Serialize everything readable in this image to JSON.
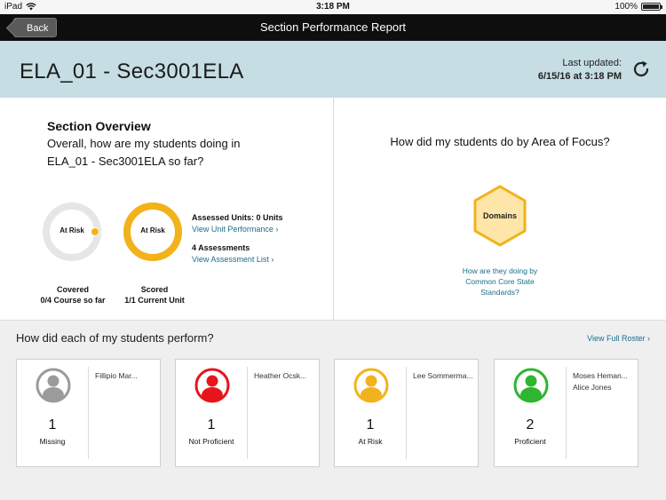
{
  "status_bar": {
    "device": "iPad",
    "time": "3:18 PM",
    "battery": "100%"
  },
  "nav": {
    "back_label": "Back",
    "title": "Section Performance Report"
  },
  "header": {
    "section_title": "ELA_01 - Sec3001ELA",
    "last_updated_label": "Last updated:",
    "last_updated_value": "6/15/16 at 3:18 PM"
  },
  "overview": {
    "heading": "Section Overview",
    "question_line1": "Overall, how are my students doing in",
    "question_line2": "ELA_01 - Sec3001ELA so far?",
    "covered": {
      "ring_label": "At Risk",
      "caption_title": "Covered",
      "caption_value": "0/4 Course so far"
    },
    "scored": {
      "ring_label": "At Risk",
      "caption_title": "Scored",
      "caption_value": "1/1 Current Unit"
    },
    "assessed_units": "Assessed Units: 0 Units",
    "view_unit_performance": "View Unit Performance ›",
    "assessments_count": "4 Assessments",
    "view_assessment_list": "View Assessment List ›"
  },
  "area_of_focus": {
    "question": "How did my students do by Area of Focus?",
    "domains_label": "Domains",
    "link_line1": "How are they doing by",
    "link_line2": "Common Core State",
    "link_line3": "Standards?"
  },
  "students": {
    "heading": "How did each of my students perform?",
    "roster_link": "View Full Roster ›",
    "cards": [
      {
        "count": "1",
        "status": "Missing",
        "color": "#9b9b9b",
        "names": [
          "Fillipio Mar..."
        ]
      },
      {
        "count": "1",
        "status": "Not Proficient",
        "color": "#e8141c",
        "names": [
          "Heather Ocsk..."
        ]
      },
      {
        "count": "1",
        "status": "At Risk",
        "color": "#f2b21b",
        "names": [
          "Lee Sommerma..."
        ]
      },
      {
        "count": "2",
        "status": "Proficient",
        "color": "#2fb52f",
        "names": [
          "Moses Heman...",
          "Alice Jones"
        ]
      }
    ]
  },
  "colors": {
    "nav_bg": "#0e0e0e",
    "header_bg": "#c5dde3",
    "accent_yellow": "#f2b21b",
    "link": "#1a6e8a"
  }
}
